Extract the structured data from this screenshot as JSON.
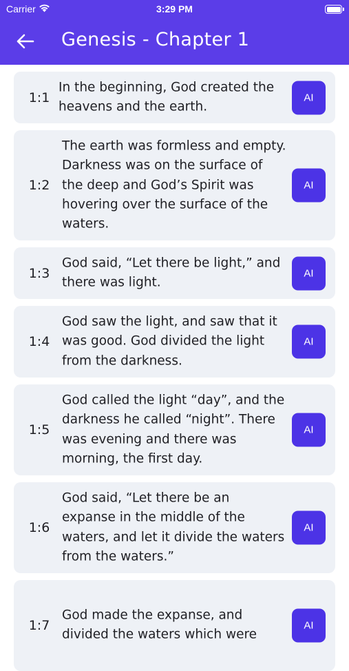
{
  "status_bar": {
    "carrier": "Carrier",
    "time": "3:29 PM"
  },
  "header": {
    "title": "Genesis - Chapter 1"
  },
  "colors": {
    "header_bg": "#5b3de8",
    "ai_button": "#4c33e6",
    "card_bg": "#eef1f6"
  },
  "verses": [
    {
      "ref": "1:1",
      "text": "In the beginning, God created the heavens and the earth.",
      "ai_label": "AI"
    },
    {
      "ref": "1:2",
      "text": "The earth was formless and empty. Darkness was on the surface of the deep and God’s Spirit was hovering over the surface of the waters.",
      "ai_label": "AI"
    },
    {
      "ref": "1:3",
      "text": "God said, “Let there be light,” and there was light.",
      "ai_label": "AI"
    },
    {
      "ref": "1:4",
      "text": "God saw the light, and saw that it was good. God divided the light from the darkness.",
      "ai_label": "AI"
    },
    {
      "ref": "1:5",
      "text": "God called the light “day”, and the darkness he called “night”. There was evening and there was morning, the first day.",
      "ai_label": "AI"
    },
    {
      "ref": "1:6",
      "text": "God said, “Let there be an expanse in the middle of the waters, and let it divide the waters from the waters.”",
      "ai_label": "AI"
    },
    {
      "ref": "1:7",
      "text": "God made the expanse, and divided the waters which were",
      "ai_label": "AI"
    }
  ]
}
